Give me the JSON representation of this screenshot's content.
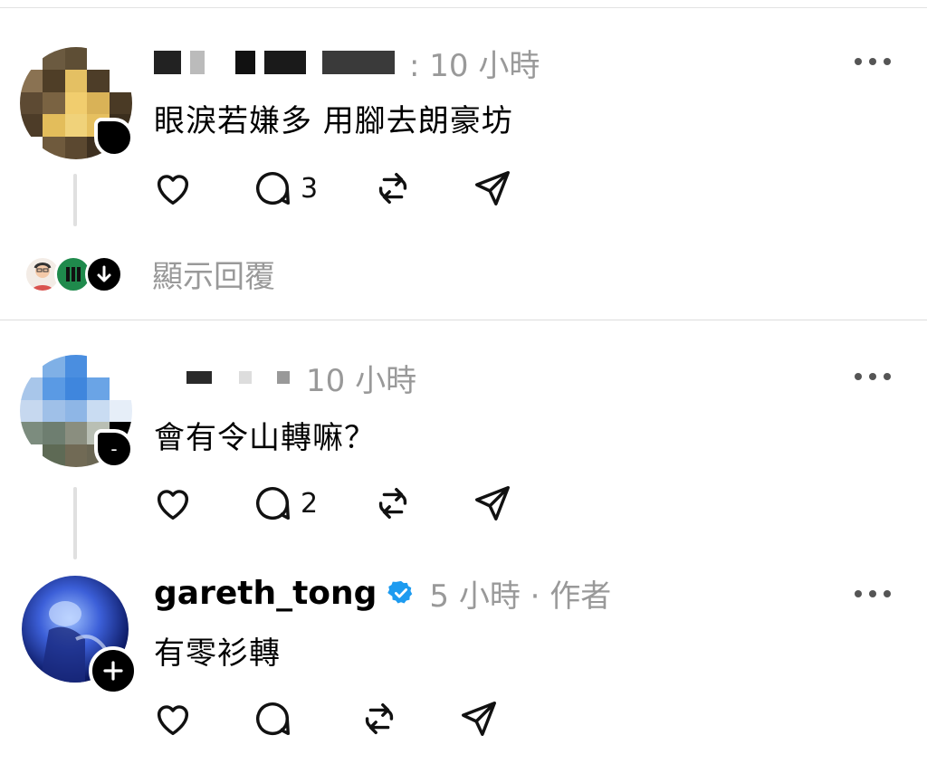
{
  "posts": [
    {
      "username": "",
      "time": ": 10 小時",
      "text": "眼淚若嫌多 用腳去朗豪坊",
      "reply_count": "3",
      "show_replies": "顯示回覆"
    },
    {
      "username": "",
      "time": "10 小時",
      "text": "會有令山轉嘛？",
      "reply_count": "2"
    },
    {
      "username": "gareth_tong",
      "time": "5 小時 · 作者",
      "text": "有零衫轉",
      "reply_count": ""
    }
  ],
  "icons": {
    "like": "heart-icon",
    "comment": "comment-bubble-icon",
    "repost": "repost-icon",
    "share": "send-icon",
    "more": "more-horizontal-icon",
    "verified": "verified-badge-icon",
    "follow": "plus-icon"
  },
  "colors": {
    "verified": "#1d9bf0",
    "secondary_text": "#999999"
  }
}
